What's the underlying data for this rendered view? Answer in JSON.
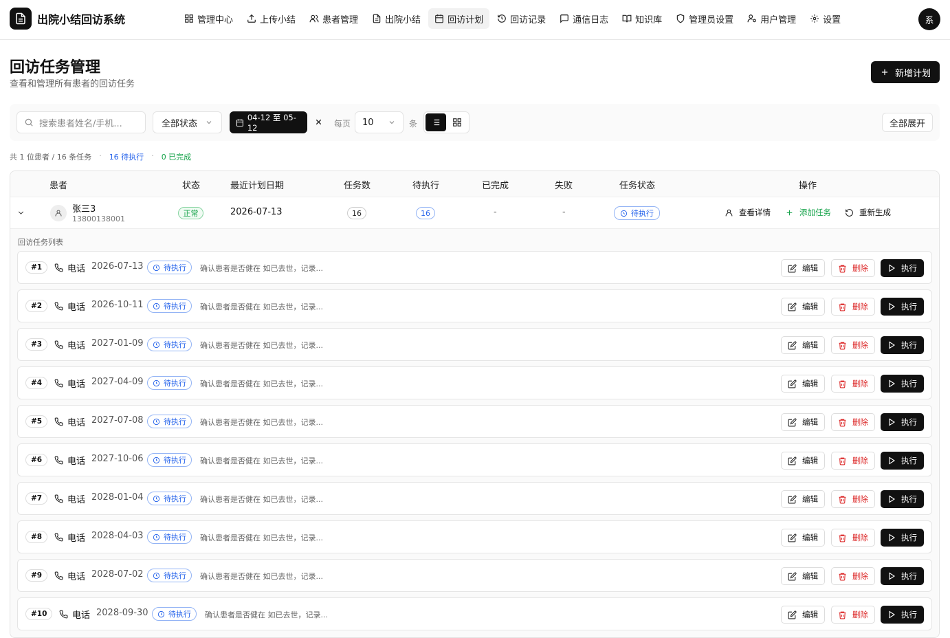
{
  "app": {
    "title": "出院小结回访系统",
    "avatar_text": "系"
  },
  "nav": [
    {
      "label": "管理中心",
      "icon": "grid-icon"
    },
    {
      "label": "上传小结",
      "icon": "upload-icon"
    },
    {
      "label": "患者管理",
      "icon": "users-icon"
    },
    {
      "label": "出院小结",
      "icon": "file-text-icon"
    },
    {
      "label": "回访计划",
      "icon": "calendar-icon",
      "active": true
    },
    {
      "label": "回访记录",
      "icon": "history-icon"
    },
    {
      "label": "通信日志",
      "icon": "message-icon"
    },
    {
      "label": "知识库",
      "icon": "book-icon"
    },
    {
      "label": "管理员设置",
      "icon": "shield-icon"
    },
    {
      "label": "用户管理",
      "icon": "user-cog-icon"
    },
    {
      "label": "设置",
      "icon": "gear-icon"
    }
  ],
  "page": {
    "title": "回访任务管理",
    "subtitle": "查看和管理所有患者的回访任务",
    "new_button": "新增计划"
  },
  "filters": {
    "search_placeholder": "搜索患者姓名/手机...",
    "status": "全部状态",
    "date_range": "04-12 至 05-12",
    "per_page_label": "每页",
    "per_page_value": "10",
    "per_page_unit": "条",
    "expand_all": "全部展开"
  },
  "summary": {
    "counts": "共 1 位患者 / 16 条任务",
    "pending": "16 待执行",
    "completed": "0 已完成"
  },
  "columns": [
    "患者",
    "状态",
    "最近计划日期",
    "任务数",
    "待执行",
    "已完成",
    "失败",
    "任务状态",
    "操作"
  ],
  "patient": {
    "name": "张三3",
    "phone": "13800138001",
    "status": "正常",
    "latest_date": "2026-07-13",
    "task_count": "16",
    "pending": "16",
    "completed": "-",
    "failed": "-",
    "task_status": "待执行",
    "actions": {
      "view": "查看详情",
      "add": "添加任务",
      "regen": "重新生成"
    }
  },
  "task_list_label": "回访任务列表",
  "task_buttons": {
    "edit": "编辑",
    "delete": "删除",
    "execute": "执行"
  },
  "tasks": [
    {
      "num": "#1",
      "type": "电话",
      "date": "2026-07-13",
      "status": "待执行",
      "desc": "确认患者是否健在 如已去世，记录..."
    },
    {
      "num": "#2",
      "type": "电话",
      "date": "2026-10-11",
      "status": "待执行",
      "desc": "确认患者是否健在 如已去世，记录..."
    },
    {
      "num": "#3",
      "type": "电话",
      "date": "2027-01-09",
      "status": "待执行",
      "desc": "确认患者是否健在 如已去世，记录..."
    },
    {
      "num": "#4",
      "type": "电话",
      "date": "2027-04-09",
      "status": "待执行",
      "desc": "确认患者是否健在 如已去世，记录..."
    },
    {
      "num": "#5",
      "type": "电话",
      "date": "2027-07-08",
      "status": "待执行",
      "desc": "确认患者是否健在 如已去世，记录..."
    },
    {
      "num": "#6",
      "type": "电话",
      "date": "2027-10-06",
      "status": "待执行",
      "desc": "确认患者是否健在 如已去世，记录..."
    },
    {
      "num": "#7",
      "type": "电话",
      "date": "2028-01-04",
      "status": "待执行",
      "desc": "确认患者是否健在 如已去世，记录..."
    },
    {
      "num": "#8",
      "type": "电话",
      "date": "2028-04-03",
      "status": "待执行",
      "desc": "确认患者是否健在 如已去世，记录..."
    },
    {
      "num": "#9",
      "type": "电话",
      "date": "2028-07-02",
      "status": "待执行",
      "desc": "确认患者是否健在 如已去世，记录..."
    },
    {
      "num": "#10",
      "type": "电话",
      "date": "2028-09-30",
      "status": "待执行",
      "desc": "确认患者是否健在 如已去世，记录..."
    }
  ],
  "colors": {
    "accent": "#111111",
    "pending": "#2563eb",
    "success": "#16a34a",
    "danger": "#dc2626"
  }
}
